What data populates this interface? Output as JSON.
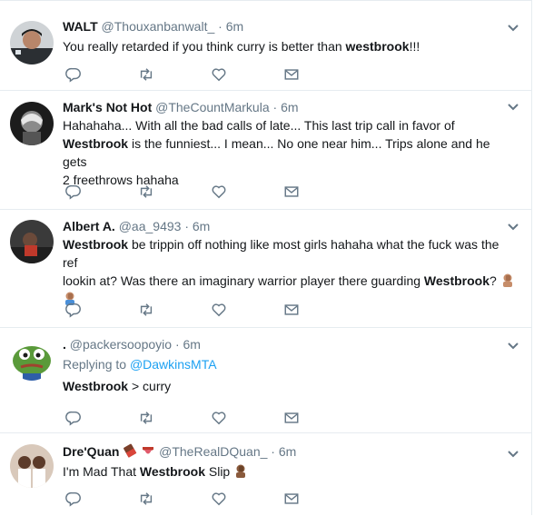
{
  "tweets": [
    {
      "name": "WALT",
      "handle": "@Thouxanbanwalt_",
      "sep": "·",
      "time": "6m",
      "text_parts": [
        "You really retarded if you think curry is better than ",
        "westbrook",
        "!!!"
      ]
    },
    {
      "name": "Mark's Not Hot",
      "handle": "@TheCountMarkula",
      "sep": "·",
      "time": "6m",
      "line1": "Hahahaha...  With all the bad calls of late...  This last trip call in favor of",
      "line2_bold": "Westbrook",
      "line2_rest": " is the funniest...  I mean...  No one near him...  Trips alone and he gets",
      "line3": "2 freethrows hahaha"
    },
    {
      "name": "Albert A.",
      "handle": "@aa_9493",
      "sep": "·",
      "time": "6m",
      "line1_bold": "Westbrook",
      "line1_rest": " be trippin off nothing like most girls hahaha what the fuck was the ref",
      "line2_rest": "lookin at? Was there an imaginary warrior player there guarding ",
      "line2_bold": "Westbrook",
      "line2_end": "?"
    },
    {
      "name": ".",
      "handle": "@packersoopoyio",
      "sep": "·",
      "time": "6m",
      "replying_prefix": "Replying to ",
      "replying_to": "@DawkinsMTA",
      "text_bold": "Westbrook",
      "text_rest": " > curry"
    },
    {
      "name": "Dre'Quan",
      "handle": "@TheRealDQuan_",
      "sep": "·",
      "time": "6m",
      "text_rest": "I'm Mad That ",
      "text_bold": "Westbrook",
      "text_end": " Slip"
    }
  ],
  "icons": {
    "reply": "reply-icon",
    "retweet": "retweet-icon",
    "like": "like-heart-icon",
    "dm": "direct-message-icon",
    "caret": "chevron-down-icon"
  },
  "colors": {
    "icon_gray": "#657786",
    "link_blue": "#1da1f2",
    "divider": "#e6ecf0"
  }
}
